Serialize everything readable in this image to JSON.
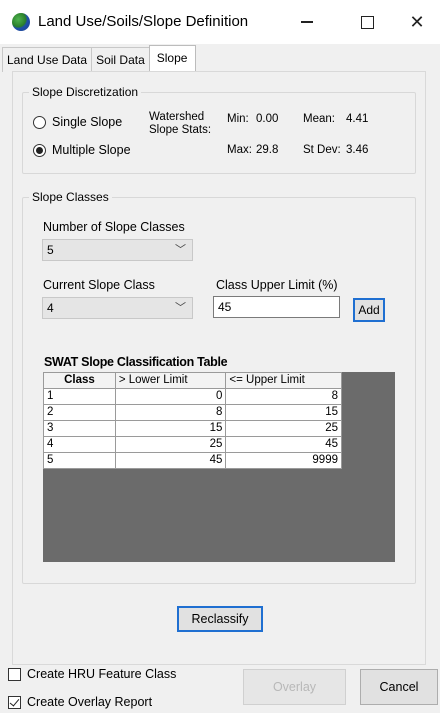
{
  "window": {
    "title": "Land Use/Soils/Slope Definition",
    "minimize_glyph": "—",
    "close_glyph": "✕"
  },
  "tabs": [
    {
      "label": "Land Use Data",
      "active": false
    },
    {
      "label": "Soil Data",
      "active": false
    },
    {
      "label": "Slope",
      "active": true
    }
  ],
  "discretization": {
    "legend": "Slope Discretization",
    "single_label": "Single Slope",
    "multiple_label": "Multiple Slope",
    "selected": "Multiple Slope",
    "stats_label_line1": "Watershed",
    "stats_label_line2": "Slope Stats:",
    "min_label": "Min:",
    "min_value": "0.00",
    "max_label": "Max:",
    "max_value": "29.8",
    "mean_label": "Mean:",
    "mean_value": "4.41",
    "stdev_label": "St Dev:",
    "stdev_value": "3.46"
  },
  "classes": {
    "legend": "Slope Classes",
    "num_classes_label": "Number of Slope Classes",
    "num_classes_value": "5",
    "current_class_label": "Current Slope Class",
    "current_class_value": "4",
    "upper_limit_label": "Class Upper Limit (%)",
    "upper_limit_value": "45",
    "add_label": "Add",
    "table_title": "SWAT Slope Classification Table",
    "table_headers": [
      "Class",
      "> Lower Limit",
      "<= Upper Limit"
    ],
    "table_rows": [
      [
        "1",
        "0",
        "8"
      ],
      [
        "2",
        "8",
        "15"
      ],
      [
        "3",
        "15",
        "25"
      ],
      [
        "4",
        "25",
        "45"
      ],
      [
        "5",
        "45",
        "9999"
      ]
    ]
  },
  "reclassify_label": "Reclassify",
  "footer": {
    "create_hru_label": "Create HRU Feature Class",
    "create_hru_checked": false,
    "create_overlay_label": "Create Overlay Report",
    "create_overlay_checked": true,
    "overlay_label": "Overlay",
    "cancel_label": "Cancel"
  },
  "colors": {
    "focus_border": "#1f6fd1",
    "grid_background": "#6b6b6b",
    "dialog_background": "#f0f0f0"
  }
}
